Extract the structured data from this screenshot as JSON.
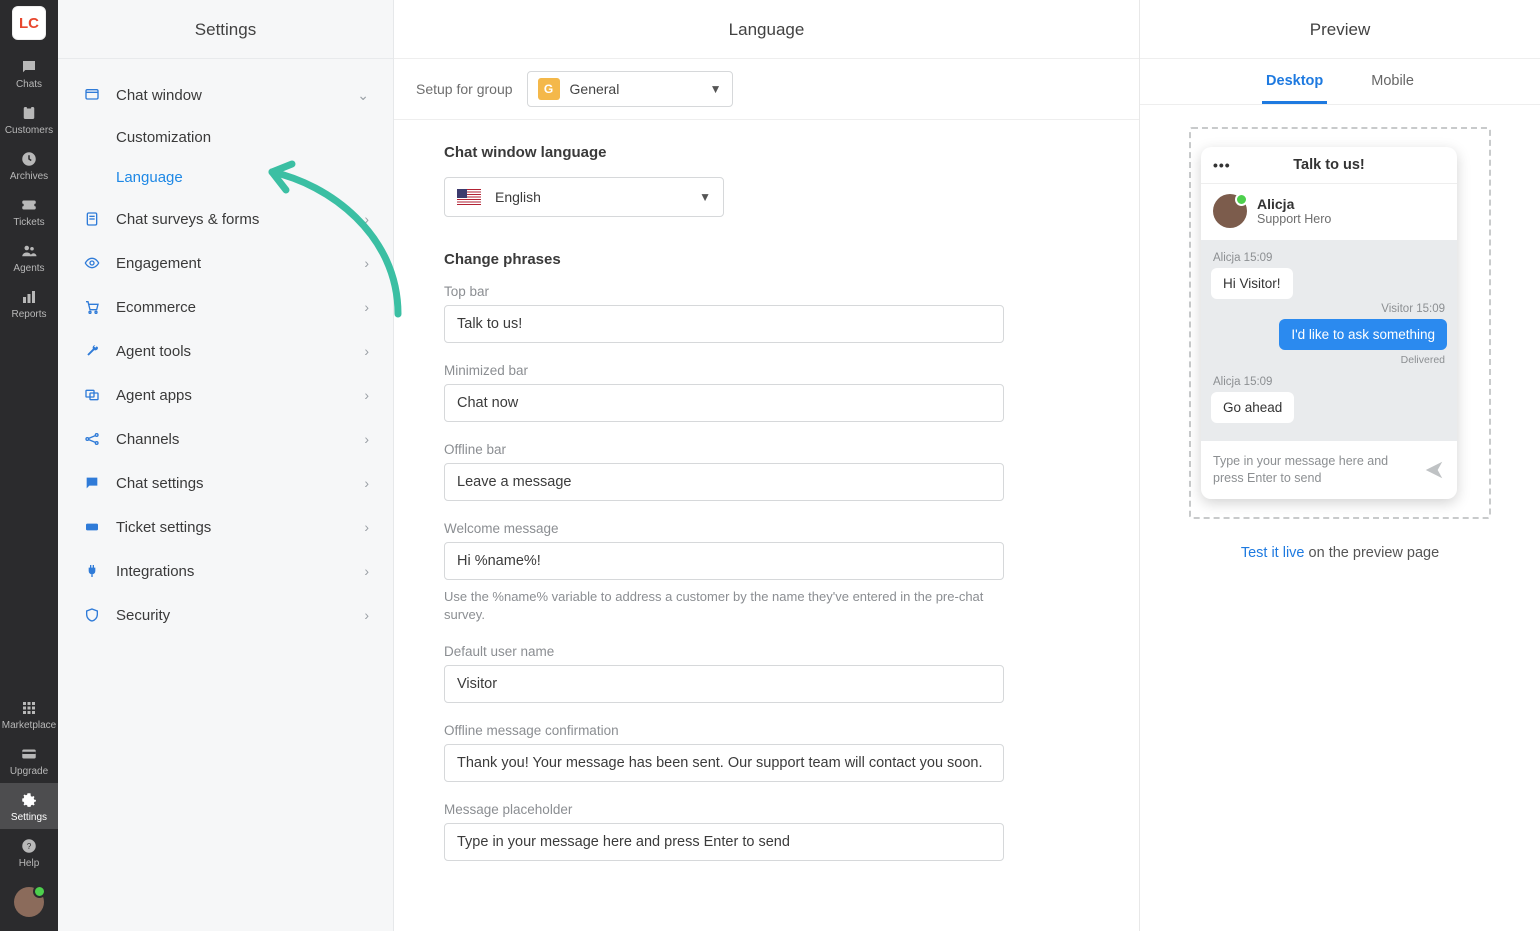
{
  "rail": {
    "items": [
      {
        "label": "Chats"
      },
      {
        "label": "Customers"
      },
      {
        "label": "Archives"
      },
      {
        "label": "Tickets"
      },
      {
        "label": "Agents"
      },
      {
        "label": "Reports"
      }
    ],
    "bottom": [
      {
        "label": "Marketplace"
      },
      {
        "label": "Upgrade"
      },
      {
        "label": "Settings"
      },
      {
        "label": "Help"
      }
    ],
    "logo_text": "LC"
  },
  "sidebar": {
    "title": "Settings",
    "items": [
      {
        "label": "Chat window",
        "expanded": true
      },
      {
        "label": "Chat surveys & forms"
      },
      {
        "label": "Engagement"
      },
      {
        "label": "Ecommerce"
      },
      {
        "label": "Agent tools"
      },
      {
        "label": "Agent apps"
      },
      {
        "label": "Channels"
      },
      {
        "label": "Chat settings"
      },
      {
        "label": "Ticket settings"
      },
      {
        "label": "Integrations"
      },
      {
        "label": "Security"
      }
    ],
    "sub": {
      "customization": "Customization",
      "language": "Language"
    }
  },
  "main": {
    "title": "Language",
    "group_label": "Setup for group",
    "group_chip": "G",
    "group_name": "General",
    "sec_window_lang": "Chat window language",
    "lang_value": "English",
    "sec_change_phrases": "Change phrases",
    "fields": {
      "top_bar": {
        "label": "Top bar",
        "value": "Talk to us!"
      },
      "minimized_bar": {
        "label": "Minimized bar",
        "value": "Chat now"
      },
      "offline_bar": {
        "label": "Offline bar",
        "value": "Leave a message"
      },
      "welcome": {
        "label": "Welcome message",
        "value": "Hi %name%!"
      },
      "welcome_helper": "Use the %name% variable to address a customer by the name they've entered in the pre-chat survey.",
      "default_user": {
        "label": "Default user name",
        "value": "Visitor"
      },
      "offline_conf": {
        "label": "Offline message confirmation",
        "value": "Thank you! Your message has been sent. Our support team will contact you soon."
      },
      "placeholder": {
        "label": "Message placeholder",
        "value": "Type in your message here and press Enter to send"
      }
    }
  },
  "preview": {
    "title": "Preview",
    "tabs": {
      "desktop": "Desktop",
      "mobile": "Mobile"
    },
    "chat": {
      "title": "Talk to us!",
      "agent_name": "Alicja",
      "agent_role": "Support Hero",
      "meta1": "Alicja 15:09",
      "msg1": "Hi Visitor!",
      "meta2": "Visitor 15:09",
      "msg2": "I'd like to ask something",
      "delivered": "Delivered",
      "meta3": "Alicja 15:09",
      "msg3": "Go ahead",
      "input_ph": "Type in your message here and press Enter to send"
    },
    "test_link": "Test it live",
    "test_rest": " on the preview page"
  }
}
